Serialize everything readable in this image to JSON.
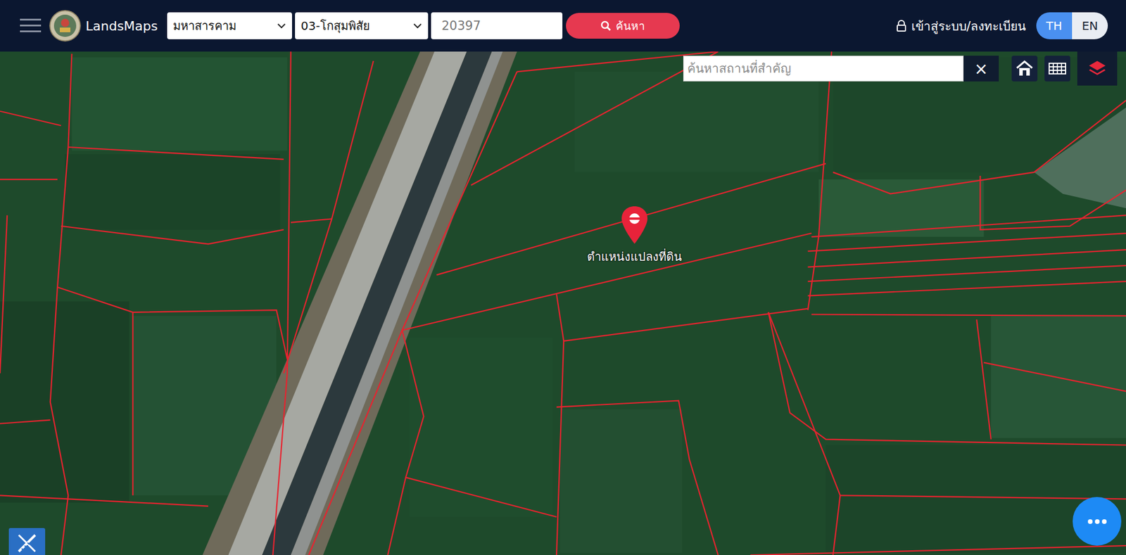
{
  "navbar": {
    "brand": "LandsMaps",
    "province": "มหาสารคาม",
    "district": "03-โกสุมพิสัย",
    "parcel_number": "20397",
    "search_button": "ค้นหา",
    "login": "เข้าสู่ระบบ/ลงทะเบียน",
    "languages": [
      {
        "label": "TH",
        "selected": true
      },
      {
        "label": "EN",
        "selected": false
      }
    ]
  },
  "map": {
    "place_search": {
      "placeholder": "ค้นหาสถานที่สำคัญ"
    },
    "clear": "×",
    "marker": {
      "label": "ตำแหน่งแปลงที่ดิน"
    }
  }
}
